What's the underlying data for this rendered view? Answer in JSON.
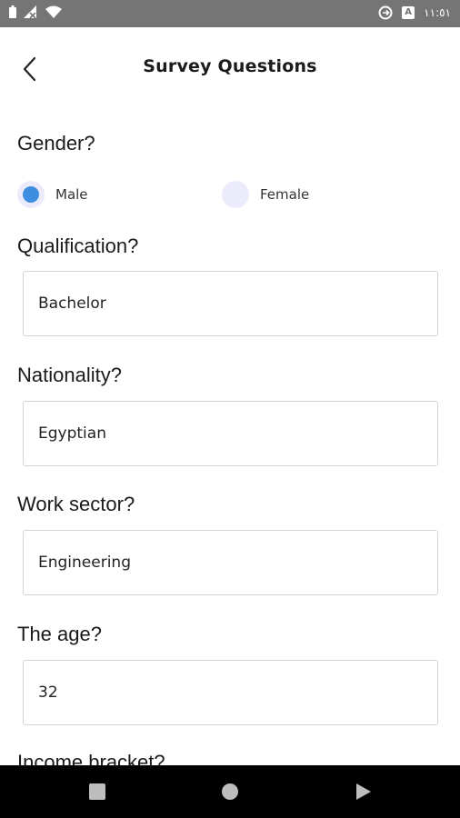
{
  "status_bar": {
    "time": "١١:٥١",
    "left_icons": [
      "battery-icon",
      "signal-icon",
      "wifi-icon"
    ],
    "right_icons": [
      "sync-icon",
      "keyboard-a-icon"
    ],
    "a_badge": "A",
    "background": "#757575"
  },
  "app_bar": {
    "title": "Survey Questions",
    "back_icon": "chevron-left-icon"
  },
  "form": {
    "gender": {
      "label": "Gender?",
      "options": [
        "Male",
        "Female"
      ],
      "selected": "Male",
      "accent": "#3f8de0"
    },
    "qualification": {
      "label": "Qualification?",
      "value": "Bachelor"
    },
    "nationality": {
      "label": "Nationality?",
      "value": "Egyptian"
    },
    "work_sector": {
      "label": "Work sector?",
      "value": "Engineering"
    },
    "age": {
      "label": "The age?",
      "value": "32"
    },
    "income": {
      "label": "Income bracket?"
    }
  },
  "nav_bar": {
    "buttons": [
      "recents-square-icon",
      "home-circle-icon",
      "back-triangle-icon"
    ]
  }
}
